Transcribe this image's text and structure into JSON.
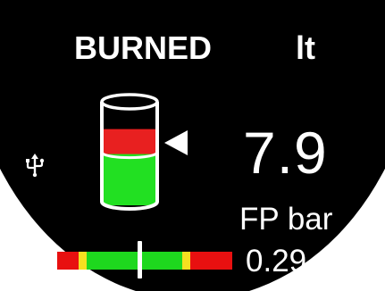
{
  "header": {
    "title": "BURNED",
    "unit": "lt"
  },
  "main": {
    "value": "7.9",
    "tank_fill_fraction": 0.55
  },
  "pressure": {
    "label": "FP bar",
    "value": "0.29",
    "needle_fraction": 0.47
  },
  "icons": {
    "usb": "usb-icon",
    "tank": "fuel-tank-icon",
    "pointer": "triangle-pointer-icon"
  },
  "colors": {
    "background": "#000000",
    "text": "#ffffff",
    "tank_green": "#22e022",
    "tank_red": "#e82020",
    "gauge_red": "#e81010",
    "gauge_yellow": "#f5e020",
    "gauge_green": "#1ed81e"
  }
}
